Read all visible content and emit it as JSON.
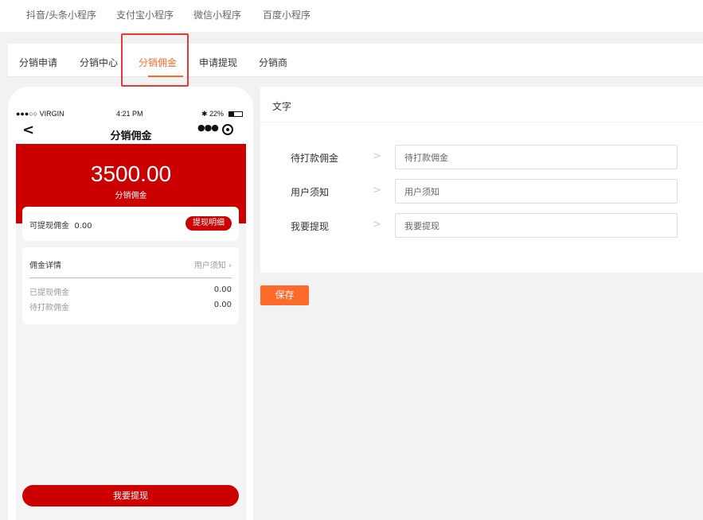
{
  "platform_tabs": [
    "抖音/头条小程序",
    "支付宝小程序",
    "微信小程序",
    "百度小程序"
  ],
  "sub_tabs": [
    "分销申请",
    "分销中心",
    "分销佣金",
    "申请提现",
    "分销商"
  ],
  "active_sub_tab": "分销佣金",
  "accent_color": "#ff6a2b",
  "brand_red": "#cc0000",
  "phone": {
    "status": {
      "carrier": "●●●○○ VIRGIN",
      "time": "4:21 PM",
      "battery": "22%"
    },
    "nav_title": "分销佣金",
    "amount": "3500.00",
    "amount_label": "分销佣金",
    "withdrawable_label": "可提现佣金",
    "withdrawable_value": "0.00",
    "detail_button": "提现明细",
    "detail_title": "佣金详情",
    "user_notice": "用户须知 ›",
    "rows": [
      {
        "label": "已提现佣金",
        "value": "0.00"
      },
      {
        "label": "待打款佣金",
        "value": "0.00"
      }
    ],
    "withdraw_button": "我要提现"
  },
  "panel": {
    "header": "文字",
    "fields": [
      {
        "label": "待打款佣金",
        "value": "待打款佣金"
      },
      {
        "label": "用户须知",
        "value": "用户须知"
      },
      {
        "label": "我要提现",
        "value": "我要提现"
      }
    ]
  },
  "save_label": "保存"
}
